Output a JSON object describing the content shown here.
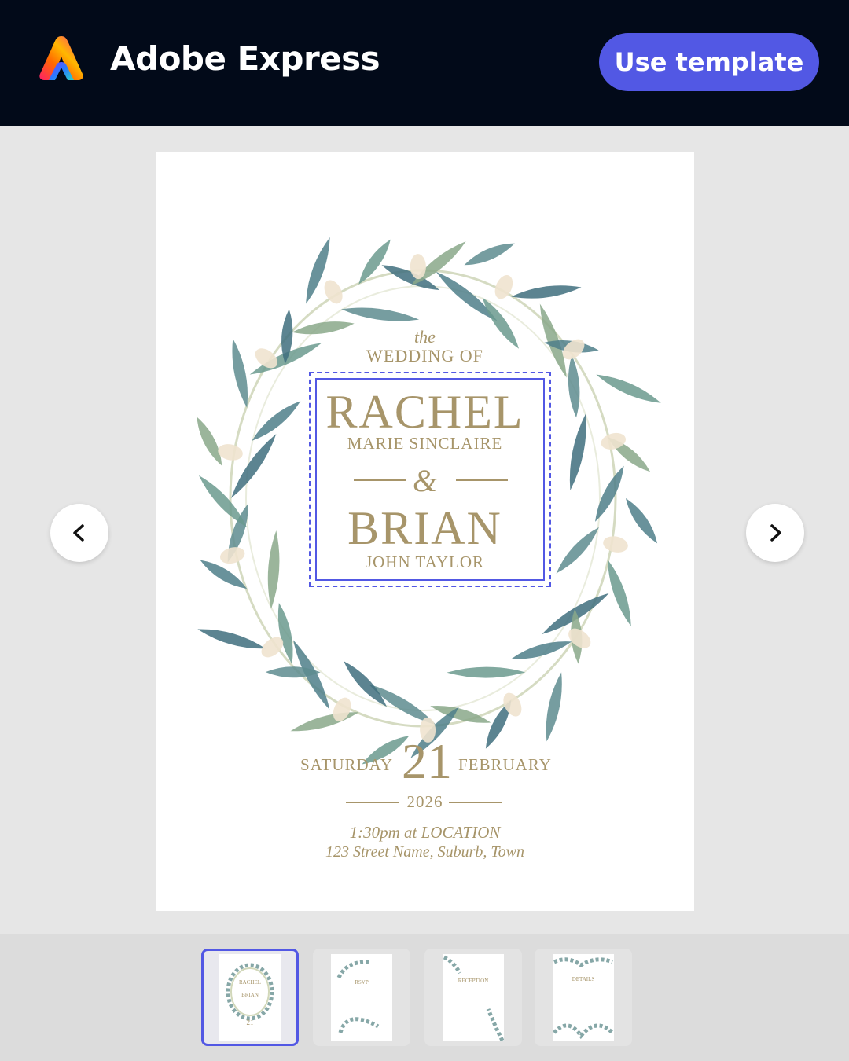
{
  "header": {
    "app_name": "Adobe Express",
    "use_template_label": "Use template",
    "brand_color": "#5258e4",
    "background": "#020a19"
  },
  "invitation": {
    "the": "the",
    "wedding_of": "WEDDING OF",
    "name1": "RACHEL",
    "name1_middle": "MARIE SINCLAIRE",
    "ampersand": "&",
    "name2": "BRIAN",
    "name2_middle": "JOHN TAYLOR",
    "weekday": "SATURDAY",
    "day": "21",
    "month": "FEBRUARY",
    "year": "2026",
    "time_location": "1:30pm at LOCATION",
    "address": "123 Street Name, Suburb, Town",
    "text_color": "#a7956a"
  },
  "navigation": {
    "prev_icon": "chevron-left-icon",
    "next_icon": "chevron-right-icon"
  },
  "thumbnails": [
    {
      "page": "invitation",
      "active": true
    },
    {
      "page": "rsvp",
      "label": "RSVP",
      "active": false
    },
    {
      "page": "reception",
      "label": "RECEPTION",
      "active": false
    },
    {
      "page": "details",
      "label": "DETAILS",
      "active": false
    }
  ]
}
